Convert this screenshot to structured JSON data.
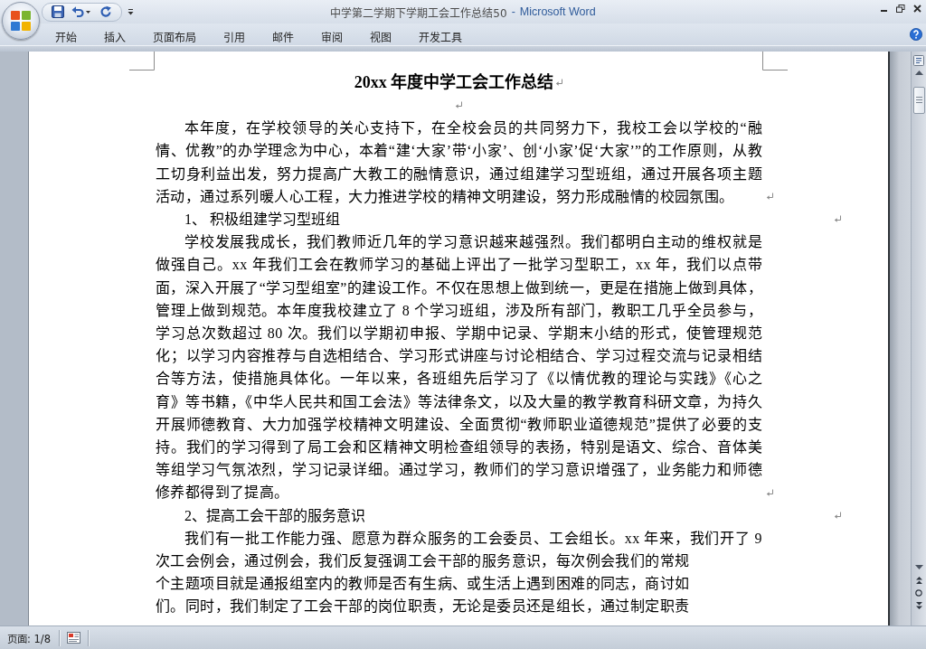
{
  "window": {
    "document_name": "中学第二学期下学期工会工作总结50",
    "separator": "-",
    "app_name": "Microsoft Word"
  },
  "ribbon": {
    "tabs": [
      {
        "label": "开始",
        "selected": false
      },
      {
        "label": "插入",
        "selected": false
      },
      {
        "label": "页面布局",
        "selected": false
      },
      {
        "label": "引用",
        "selected": false
      },
      {
        "label": "邮件",
        "selected": false
      },
      {
        "label": "审阅",
        "selected": false
      },
      {
        "label": "视图",
        "selected": false
      },
      {
        "label": "开发工具",
        "selected": false
      }
    ]
  },
  "document": {
    "formatting_marks": true,
    "title": "20xx 年度中学工会工作总结",
    "blocks": [
      {
        "kind": "blank"
      },
      {
        "kind": "body",
        "parts": [
          "本年度，在学校领导的关心支持下，在全校会员的共同努力下，我校工会以学校的“融情、优教”的办学理念为中心，本着“建‘大家’带‘小家’、创‘小家’促‘大家’”的工作原则，从教工切身利益出发，努力提高广大教工的融情意识，通过组建学习型班组，通过开展各项主题活动，通过系列暖人心工程，大力推进学校的精神文明建设，努力形成融情的校园氛围。"
        ]
      },
      {
        "kind": "heading",
        "text": "1、 积极组建学习型班组"
      },
      {
        "kind": "body",
        "parts": [
          "学校发展我成长，我们教师近几年的学习意识越来越强烈。我们都明白主动的维权就是做强自己。xx 年我们工会在教师学习的基础上评出了一批学习型职工，xx 年，我们以点带面，深入开展了“学习型组室”的建设工作。不仅在思想上做到统一，更是在措施上做到具体，管理上做到规范。本年度我校建立了 8 个学习班组，涉及所有部门，教职工几乎全员参与，学习总次数超过 80 次。我们以学期初申报、学期中记录、学期末小结的形式，使管理规范化；以学习内容推荐与自选相结合、学习形式讲座与讨论相结合、学习过程交流与记录相结合等方法，使措施具体化。一年以来，各班组先后学习了《以情优教的理论与实践》《心之育》等书籍，《中华人民共和国工会法》等法律条文，以及大量的教学教育科研文章，为持久开展师德教育、大力加强学校精神文明建设、全面贯彻“教师职业道德规范”提供了必要的支持。我们的学习得到了局工会和区精神文明检查组领导的表扬，特别是语文、综合、音体美等组学习气氛浓烈，学习记录详细。通过学习，教师们的学习意识增强了，业务能力和师德修养都得到了提高。"
        ]
      },
      {
        "kind": "heading",
        "text": "2、提高工会干部的服务意识"
      },
      {
        "kind": "body",
        "parts": [
          "我们有一批工作能力强、愿意为群众服务的工会委员、工会组长。xx 年来，我们开了 9次工会例会，通过例会，我们反复强调工会干部的服务意识，每次例会我们的常规",
          "个主题项目就是通报组室内的教师是否有生病、或生活上遇到困难的同志，商讨如",
          "们。同时，我们制定了工会干部的岗位职责，无论是委员还是组长，通过制定职责"
        ]
      }
    ]
  },
  "status_bar": {
    "page": "页面: 1/8"
  }
}
